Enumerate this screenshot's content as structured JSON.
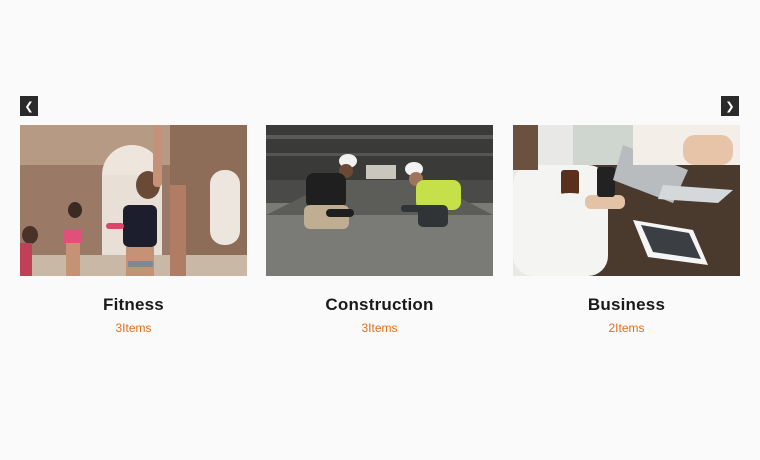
{
  "carousel": {
    "prev_icon": "chevron-left-icon",
    "next_icon": "chevron-right-icon",
    "items": [
      {
        "title": "Fitness",
        "count": "3Items",
        "image": "fitness-class-photo"
      },
      {
        "title": "Construction",
        "count": "3Items",
        "image": "construction-workers-photo"
      },
      {
        "title": "Business",
        "count": "2Items",
        "image": "business-laptop-photo"
      }
    ]
  },
  "colors": {
    "background": "#fafafa",
    "accent": "#e1701a",
    "title": "#1a1a1a",
    "arrow_bg": "#2a2a2a"
  }
}
